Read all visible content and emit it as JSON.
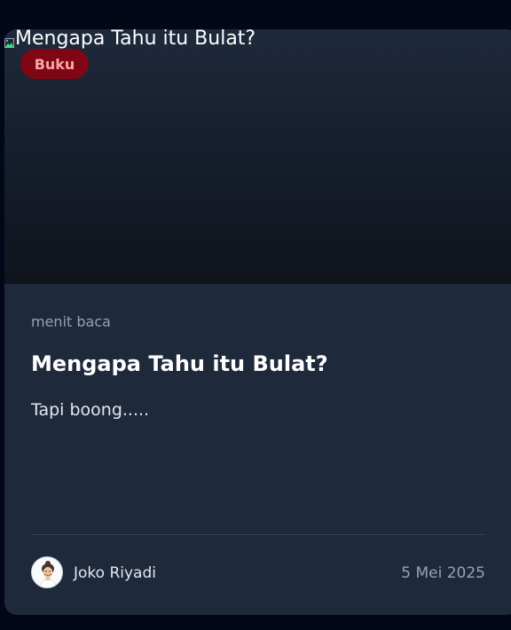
{
  "post": {
    "cover_alt": "Mengapa Tahu itu Bulat?",
    "category": "Buku",
    "read_time": "menit baca",
    "title": "Mengapa Tahu itu Bulat?",
    "excerpt": "Tapi boong.....",
    "author": {
      "name": "Joko Riyadi",
      "avatar_icon": "user-avatar-photo"
    },
    "date": "5 Mei 2025"
  },
  "colors": {
    "page_background": "#020817",
    "card_background": "#1e293b",
    "badge_background": "#7f0715",
    "badge_text": "#fca5a5",
    "muted_text": "#94a3b8"
  }
}
